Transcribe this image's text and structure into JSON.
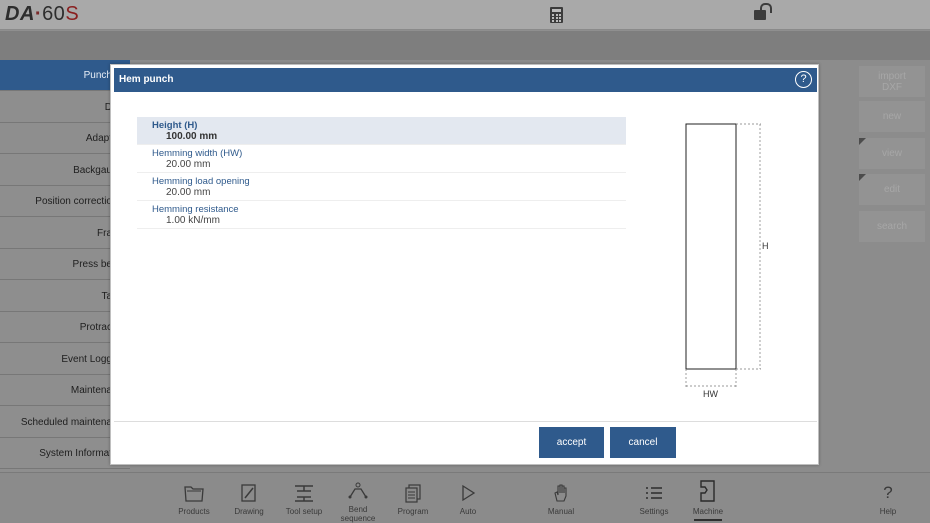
{
  "app": {
    "logo_da": "DA",
    "logo_dot": "·",
    "logo_num": "60",
    "logo_s": "S"
  },
  "sidebar": {
    "items": [
      {
        "label": "Punch"
      },
      {
        "label": "D"
      },
      {
        "label": "Adapt"
      },
      {
        "label": "Backgau"
      },
      {
        "label": "Position correctio"
      },
      {
        "label": "Fra"
      },
      {
        "label": "Press be"
      },
      {
        "label": "Ta"
      },
      {
        "label": "Protrac"
      },
      {
        "label": "Event Logg"
      },
      {
        "label": "Maintena"
      },
      {
        "label": "Scheduled maintena"
      },
      {
        "label": "System Informat"
      }
    ]
  },
  "right_buttons": {
    "import_dxf": "import\nDXF",
    "new": "new",
    "view": "view",
    "edit": "edit",
    "search": "search"
  },
  "modal": {
    "title": "Hem punch",
    "help": "?",
    "params": [
      {
        "label": "Height (H)",
        "value": "100.00 mm"
      },
      {
        "label": "Hemming width (HW)",
        "value": "20.00 mm"
      },
      {
        "label": "Hemming load opening",
        "value": "20.00 mm"
      },
      {
        "label": "Hemming resistance",
        "value": "1.00 kN/mm"
      }
    ],
    "drawing": {
      "h_label": "H",
      "hw_label": "HW"
    },
    "accept_label": "accept",
    "cancel_label": "cancel"
  },
  "bottom_nav": [
    {
      "label": "Products",
      "icon": "folder-icon"
    },
    {
      "label": "Drawing",
      "icon": "pencil-icon"
    },
    {
      "label": "Tool setup",
      "icon": "tool-setup-icon"
    },
    {
      "label": "Bend sequence",
      "icon": "bend-sequence-icon"
    },
    {
      "label": "Program",
      "icon": "program-icon"
    },
    {
      "label": "Auto",
      "icon": "play-icon"
    },
    {
      "label": "Manual",
      "icon": "hand-icon"
    },
    {
      "label": "Settings",
      "icon": "list-icon"
    },
    {
      "label": "Machine",
      "icon": "machine-icon"
    },
    {
      "label": "Help",
      "icon": "question-icon"
    }
  ]
}
